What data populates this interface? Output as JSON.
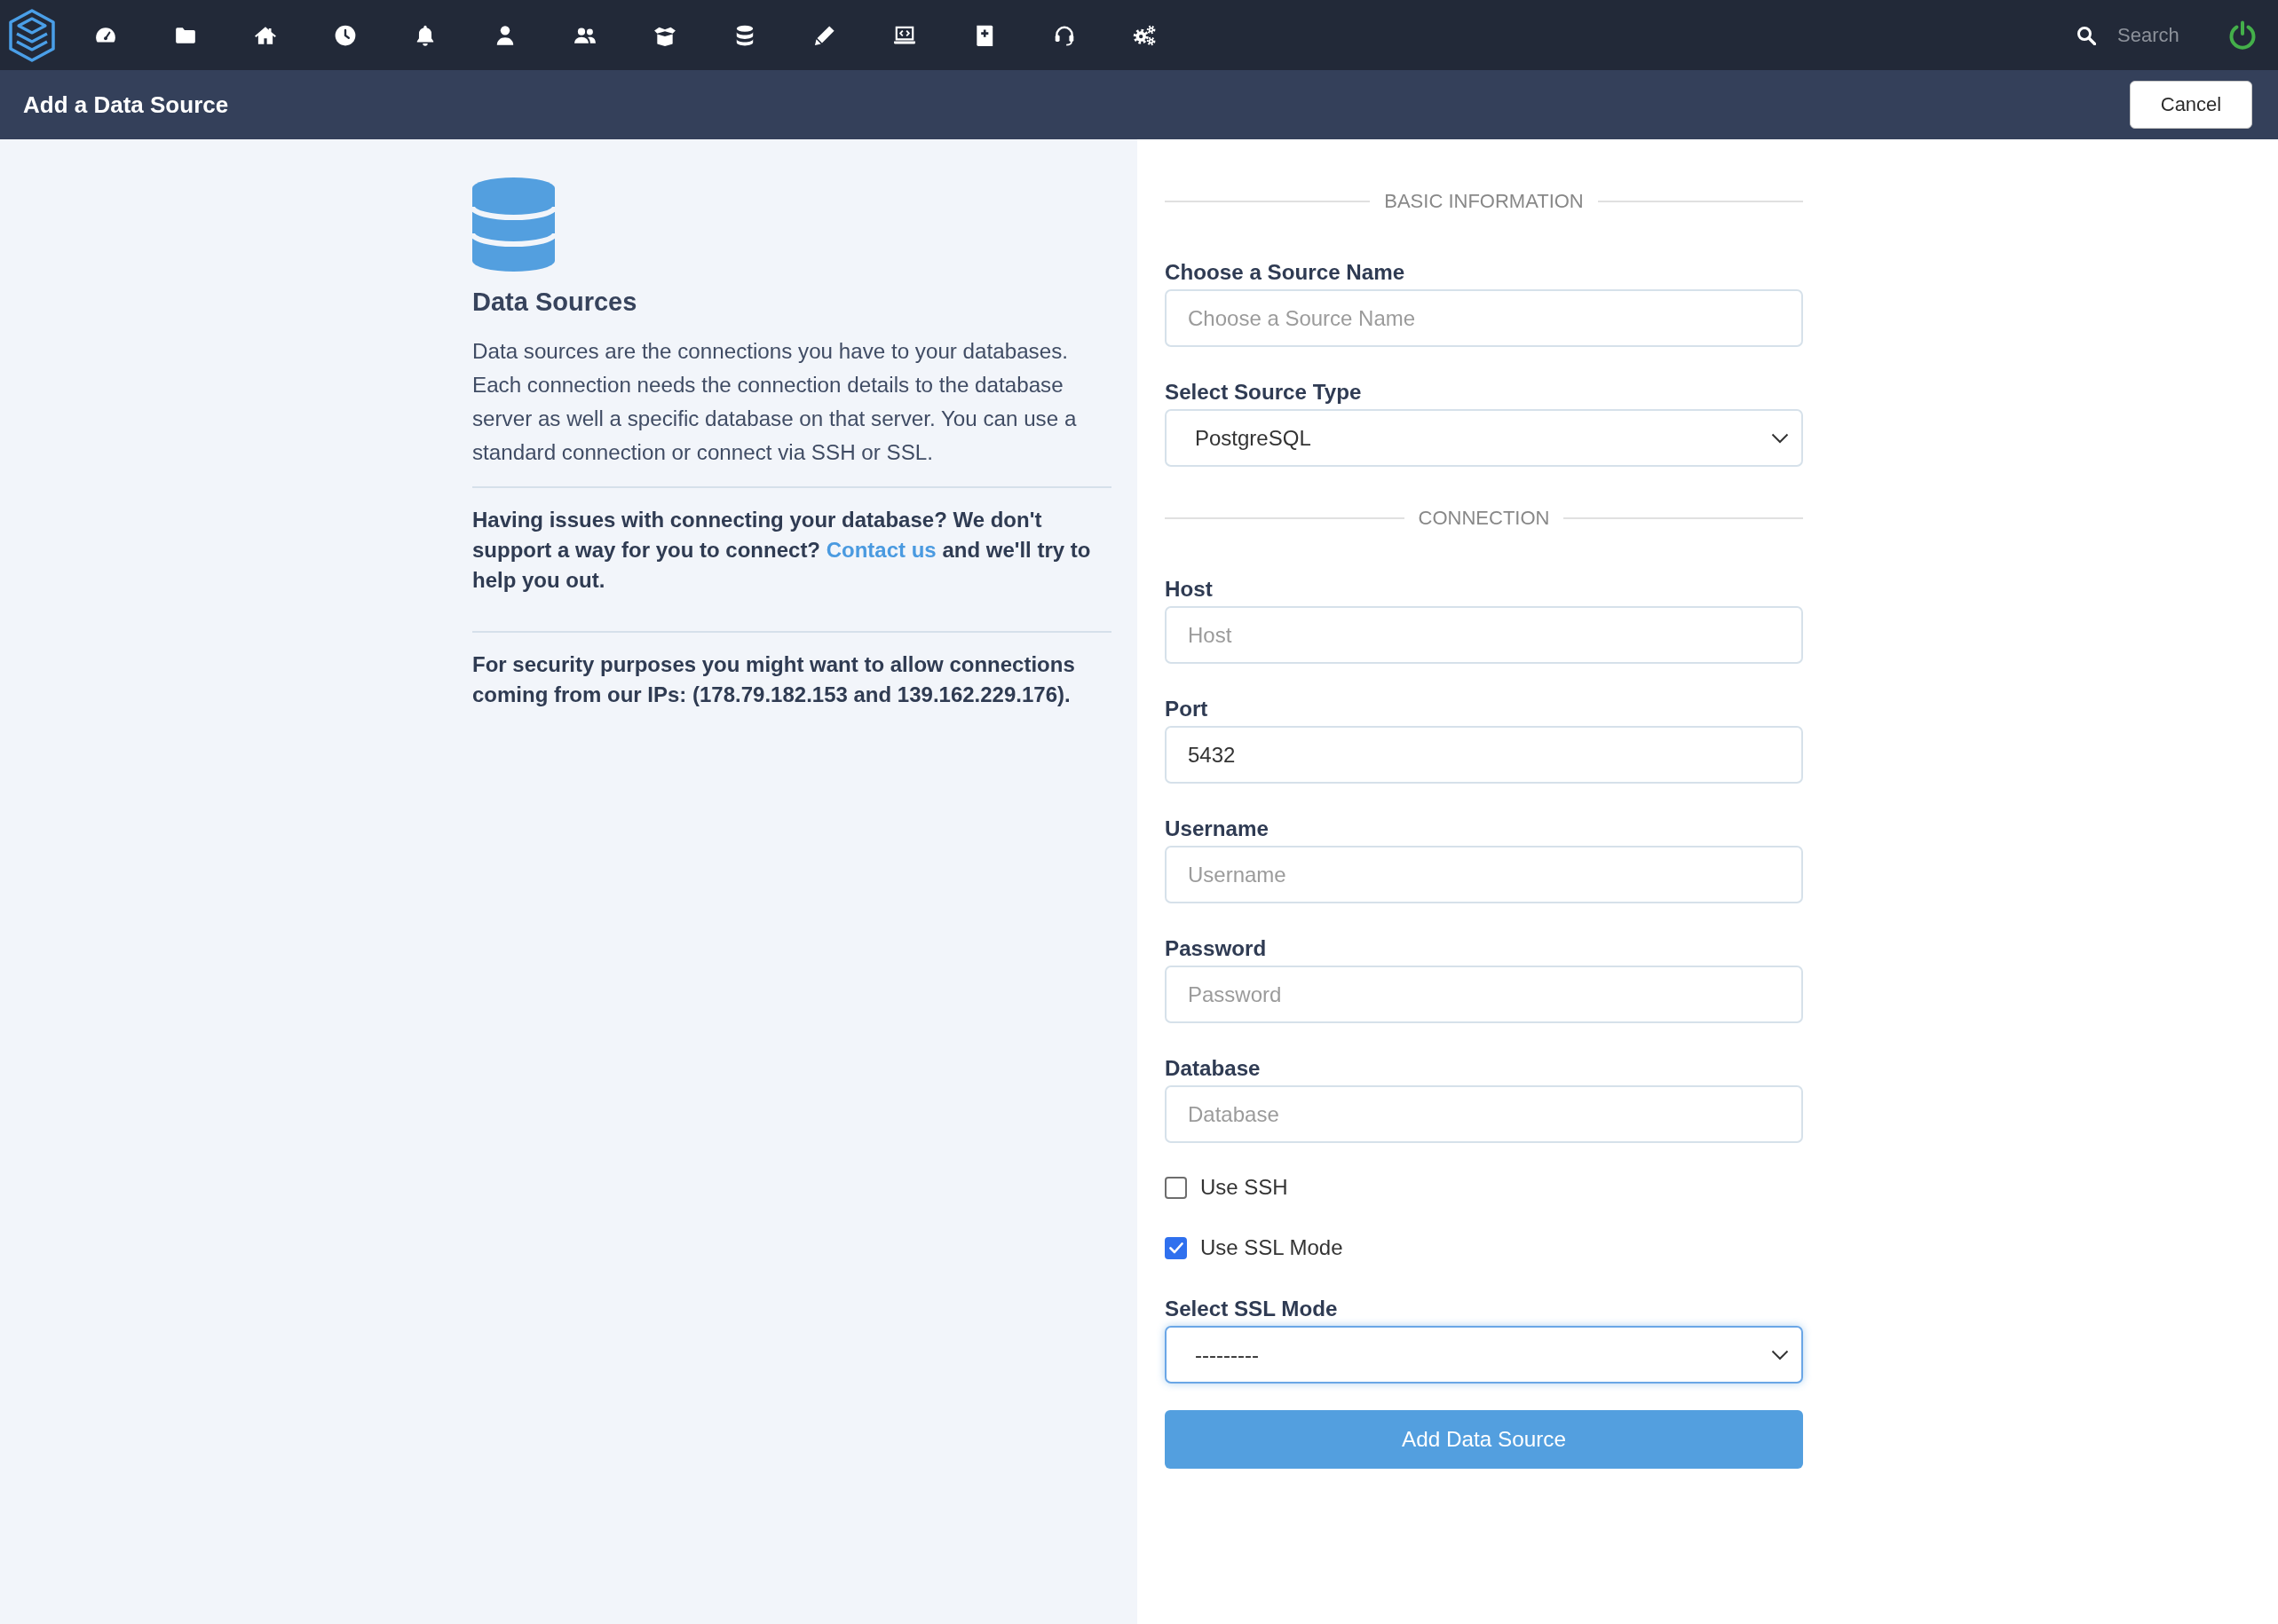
{
  "top_nav": {
    "search": {
      "placeholder": "Search"
    }
  },
  "page_header": {
    "title": "Add a Data Source",
    "cancel_button": "Cancel"
  },
  "info_panel": {
    "title": "Data Sources",
    "description": "Data sources are the connections you have to your databases. Each connection needs the connection details to the database server as well a specific database on that server. You can use a standard connection or connect via SSH or SSL.",
    "help": {
      "before": "Having issues with connecting your database? We don't support a way for you to connect?",
      "link": "Contact us",
      "after": "and we'll try to help you out."
    },
    "security_note": "For security purposes you might want to allow connections coming from our IPs: (178.79.182.153 and 139.162.229.176)."
  },
  "form": {
    "sections": [
      {
        "title": "BASIC INFORMATION",
        "fields": [
          {
            "kind": "text",
            "label": "Choose a Source Name",
            "placeholder": "Choose a Source Name",
            "focused": false
          },
          {
            "kind": "select",
            "label": "Select Source Type",
            "value": "PostgreSQL",
            "focused": false
          }
        ]
      },
      {
        "title": "CONNECTION",
        "fields": [
          {
            "kind": "text",
            "label": "Host",
            "placeholder": "Host",
            "focused": false
          },
          {
            "kind": "text",
            "label": "Port",
            "value": "5432",
            "focused": false
          },
          {
            "kind": "text",
            "label": "Username",
            "placeholder": "Username",
            "focused": false
          },
          {
            "kind": "text",
            "label": "Password",
            "placeholder": "Password",
            "focused": false
          },
          {
            "kind": "text",
            "label": "Database",
            "placeholder": "Database",
            "focused": false
          },
          {
            "kind": "checkbox",
            "label": "Use SSH",
            "checked": false
          },
          {
            "kind": "checkbox",
            "label": "Use SSL Mode",
            "checked": true
          },
          {
            "kind": "select",
            "label": "Select SSL Mode",
            "value": "---------",
            "focused": true
          }
        ]
      }
    ],
    "submit_button": "Add Data Source"
  }
}
